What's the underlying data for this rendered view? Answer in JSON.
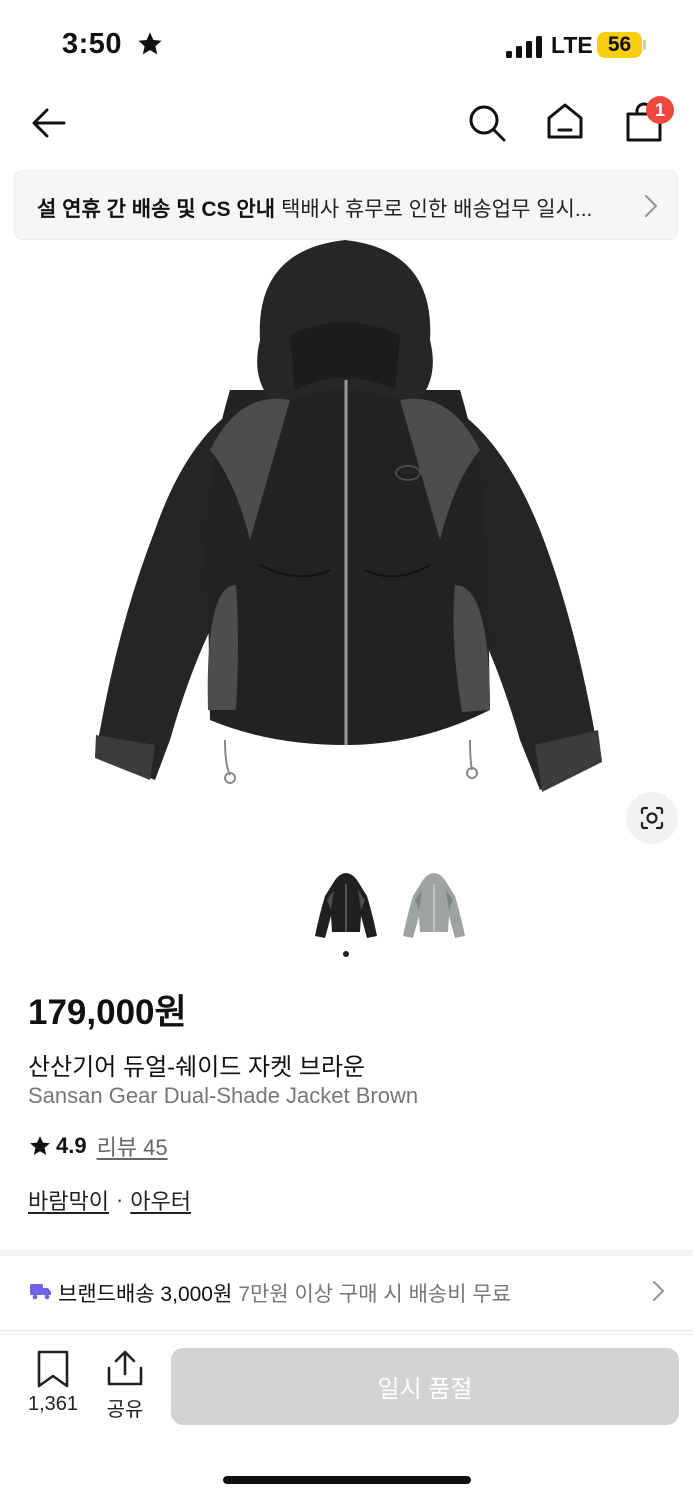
{
  "status_bar": {
    "time": "3:50",
    "network": "LTE",
    "battery": "56",
    "battery_color": "#f7cf10"
  },
  "header": {
    "icons": [
      "back-arrow-icon",
      "search-icon",
      "home-icon",
      "shopping-bag-icon"
    ],
    "cart_count": "1",
    "badge_color": "#f0483e"
  },
  "notice": {
    "title": "설 연휴 간 배송 및 CS 안내",
    "body": "택배사 휴무로 인한 배송업무 일시..."
  },
  "gallery": {
    "thumbnails": [
      "black",
      "gray"
    ],
    "current_index": 1,
    "total": 2
  },
  "product": {
    "price": "179,000원",
    "name_ko": "산산기어 듀얼-쉐이드 자켓 브라운",
    "name_en": "Sansan Gear Dual-Shade Jacket Brown",
    "rating": "4.9",
    "review_label": "리뷰 45",
    "categories": [
      "바람막이",
      "아우터"
    ],
    "category_separator": "·"
  },
  "shipping": {
    "brand": "브랜드배송 3,000원",
    "note": "7만원 이상 구매 시 배송비 무료",
    "icon_color": "#6b63e8"
  },
  "bottom_bar": {
    "like_count": "1,361",
    "share_label": "공유",
    "buy_label": "일시 품절",
    "buy_color": "#d3d3d5"
  }
}
